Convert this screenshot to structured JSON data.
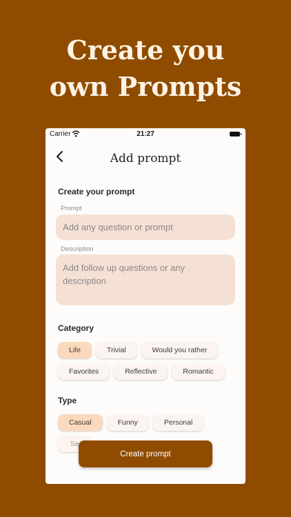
{
  "hero": {
    "line1": "Create you",
    "line2": "own Prompts"
  },
  "status_bar": {
    "carrier": "Carrier",
    "time": "21:27"
  },
  "nav": {
    "title": "Add prompt"
  },
  "form": {
    "section_title": "Create your prompt",
    "prompt_label": "Prompt",
    "prompt_placeholder": "Add any question or prompt",
    "description_label": "Description",
    "description_placeholder": "Add follow up questions or any description"
  },
  "category": {
    "title": "Category",
    "row1": [
      {
        "label": "Life",
        "selected": true
      },
      {
        "label": "Trivial",
        "selected": false
      },
      {
        "label": "Would you rather",
        "selected": false
      }
    ],
    "row2": [
      {
        "label": "Favorites",
        "selected": false
      },
      {
        "label": "Reflective",
        "selected": false
      },
      {
        "label": "Romantic",
        "selected": false
      }
    ]
  },
  "type": {
    "title": "Type",
    "row1": [
      {
        "label": "Casual",
        "selected": true
      },
      {
        "label": "Funny",
        "selected": false
      },
      {
        "label": "Personal",
        "selected": false
      }
    ],
    "row2": [
      {
        "label": "Se",
        "selected": false
      }
    ]
  },
  "cta": {
    "label": "Create prompt"
  },
  "colors": {
    "brand": "#8f4c00",
    "field_bg": "#f5e1d3",
    "chip_selected": "#fbd9bd"
  }
}
